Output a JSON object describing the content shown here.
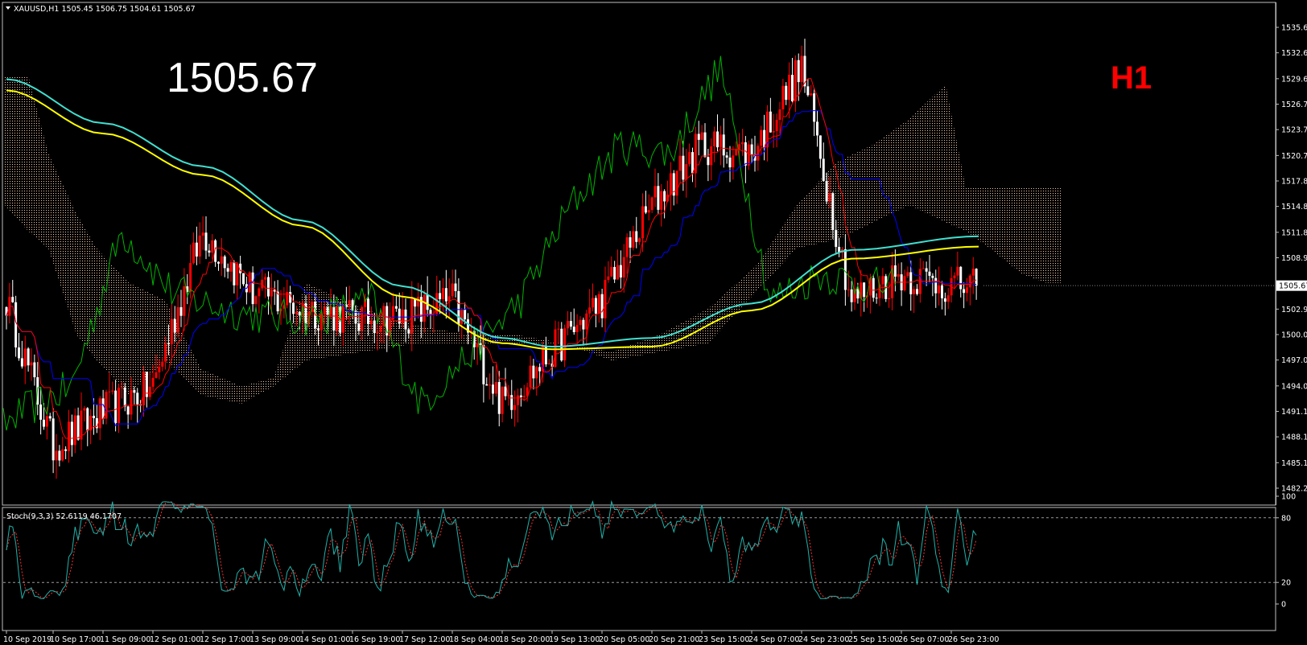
{
  "colors": {
    "background": "#000000",
    "frame": "#c0c0c0",
    "bull": "#ff0000",
    "bear": "#ffffff",
    "tenkan": "#ff0000",
    "kijun": "#0000ff",
    "chikou": "#00b400",
    "ma_fast": "#40e0d0",
    "ma_slow": "#ffff00",
    "cloud": "#f5c8a8",
    "stoch_main": "#20b2aa",
    "stoch_signal": "#ff3030",
    "timeframe": "#ff0000"
  },
  "header": {
    "menu_icon": "triangle-down-icon",
    "text": "XAUUSD,H1  1505.45 1506.75 1504.61 1505.67"
  },
  "overlay": {
    "price": "1505.67",
    "timeframe": "H1"
  },
  "price_axis": {
    "current": "1505.67",
    "ticks": [
      "1535.60",
      "1532.65",
      "1529.65",
      "1526.70",
      "1523.75",
      "1520.75",
      "1517.80",
      "1514.85",
      "1511.85",
      "1508.90",
      "1502.95",
      "1500.00",
      "1497.05",
      "1494.05",
      "1491.10",
      "1488.15",
      "1485.15",
      "1482.20"
    ]
  },
  "time_axis": {
    "ticks": [
      "10 Sep 2019",
      "10 Sep 17:00",
      "11 Sep 09:00",
      "12 Sep 01:00",
      "12 Sep 17:00",
      "13 Sep 09:00",
      "14 Sep 01:00",
      "16 Sep 19:00",
      "17 Sep 12:00",
      "18 Sep 04:00",
      "18 Sep 20:00",
      "19 Sep 13:00",
      "20 Sep 05:00",
      "20 Sep 21:00",
      "23 Sep 15:00",
      "24 Sep 07:00",
      "24 Sep 23:00",
      "25 Sep 15:00",
      "26 Sep 07:00",
      "26 Sep 23:00"
    ]
  },
  "stoch": {
    "label": "Stoch(9,3,3) 52.6119 46.1707",
    "ticks": [
      "100",
      "80",
      "20",
      "0"
    ],
    "levels": [
      80,
      20
    ]
  },
  "chart_data": {
    "type": "candlestick",
    "title": "XAUUSD,H1",
    "ylim": [
      1482.2,
      1536.5
    ],
    "approx_close_path": [
      {
        "x": "10 Sep 2019",
        "y": 1504
      },
      {
        "x": "10 Sep 17:00",
        "y": 1487
      },
      {
        "x": "11 Sep 09:00",
        "y": 1491
      },
      {
        "x": "12 Sep 01:00",
        "y": 1494
      },
      {
        "x": "12 Sep 17:00",
        "y": 1512
      },
      {
        "x": "13 Sep 09:00",
        "y": 1505
      },
      {
        "x": "14 Sep 01:00",
        "y": 1503
      },
      {
        "x": "16 Sep 19:00",
        "y": 1502
      },
      {
        "x": "17 Sep 12:00",
        "y": 1502
      },
      {
        "x": "18 Sep 04:00",
        "y": 1504
      },
      {
        "x": "18 Sep 20:00",
        "y": 1492
      },
      {
        "x": "19 Sep 13:00",
        "y": 1498
      },
      {
        "x": "20 Sep 05:00",
        "y": 1504
      },
      {
        "x": "20 Sep 21:00",
        "y": 1515
      },
      {
        "x": "23 Sep 15:00",
        "y": 1522
      },
      {
        "x": "24 Sep 07:00",
        "y": 1521
      },
      {
        "x": "24 Sep 23:00",
        "y": 1531
      },
      {
        "x": "25 Sep 15:00",
        "y": 1504
      },
      {
        "x": "26 Sep 07:00",
        "y": 1507
      },
      {
        "x": "26 Sep 23:00",
        "y": 1505.67
      }
    ],
    "series": [
      {
        "values": [
          1529.6,
          1524.5,
          1519.5,
          1513.2,
          1505.6,
          1499.6,
          1498.6,
          1499.6,
          1503.6,
          1509.8,
          1511.4
        ]
      },
      {
        "values": [
          1528.3,
          1523.3,
          1518.5,
          1512.6,
          1504.4,
          1499.0,
          1498.3,
          1498.6,
          1502.8,
          1508.8,
          1510.2
        ]
      }
    ],
    "ma_x": [
      "10 Sep 2019",
      "11 Sep 09:00",
      "12 Sep 17:00",
      "14 Sep 01:00",
      "17 Sep 12:00",
      "18 Sep 20:00",
      "19 Sep 13:00",
      "20 Sep 21:00",
      "24 Sep 07:00",
      "25 Sep 15:00",
      "26 Sep 23:00"
    ]
  }
}
